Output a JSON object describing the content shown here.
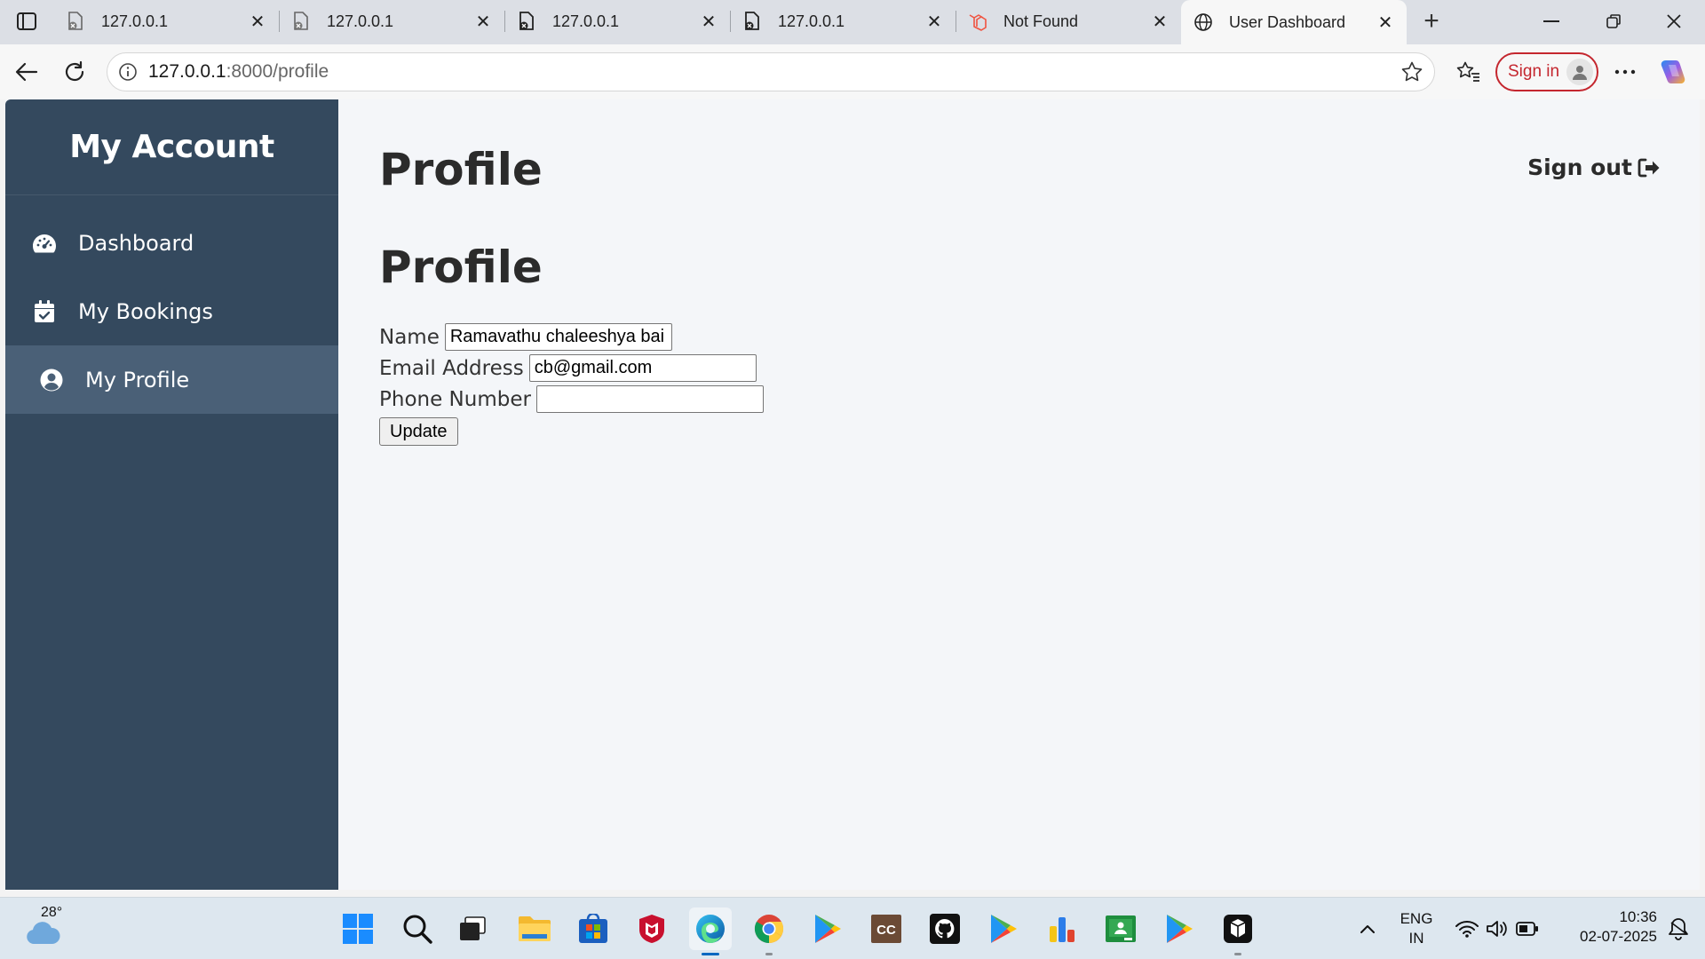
{
  "browser": {
    "tabs": [
      {
        "title": "127.0.0.1",
        "icon": "page-blocked-icon"
      },
      {
        "title": "127.0.0.1",
        "icon": "page-blocked-icon"
      },
      {
        "title": "127.0.0.1",
        "icon": "page-error-icon"
      },
      {
        "title": "127.0.0.1",
        "icon": "page-error-icon"
      },
      {
        "title": "Not Found",
        "icon": "laravel-icon"
      },
      {
        "title": "User Dashboard",
        "icon": "globe-icon"
      }
    ],
    "url_host": "127.0.0.1",
    "url_rest": ":8000/profile",
    "signin_label": "Sign in"
  },
  "sidebar": {
    "brand": "My Account",
    "items": [
      {
        "label": "Dashboard",
        "icon": "gauge-icon"
      },
      {
        "label": "My Bookings",
        "icon": "calendar-check-icon"
      },
      {
        "label": "My Profile",
        "icon": "user-circle-icon"
      }
    ]
  },
  "main": {
    "page_title": "Profile",
    "section_title": "Profile",
    "signout_label": "Sign out",
    "form": {
      "name_label": "Name",
      "name_value": "Ramavathu chaleeshya bai",
      "email_label": "Email Address",
      "email_value": "cb@gmail.com",
      "phone_label": "Phone Number",
      "phone_value": "",
      "update_label": "Update"
    }
  },
  "taskbar": {
    "temperature": "28°",
    "lang_1": "ENG",
    "lang_2": "IN",
    "time": "10:36",
    "date": "02-07-2025"
  },
  "colors": {
    "sidebar_bg": "#34495e",
    "sidebar_active": "#4a6077",
    "page_bg": "#f4f6f9",
    "signin_red": "#c4262e"
  }
}
